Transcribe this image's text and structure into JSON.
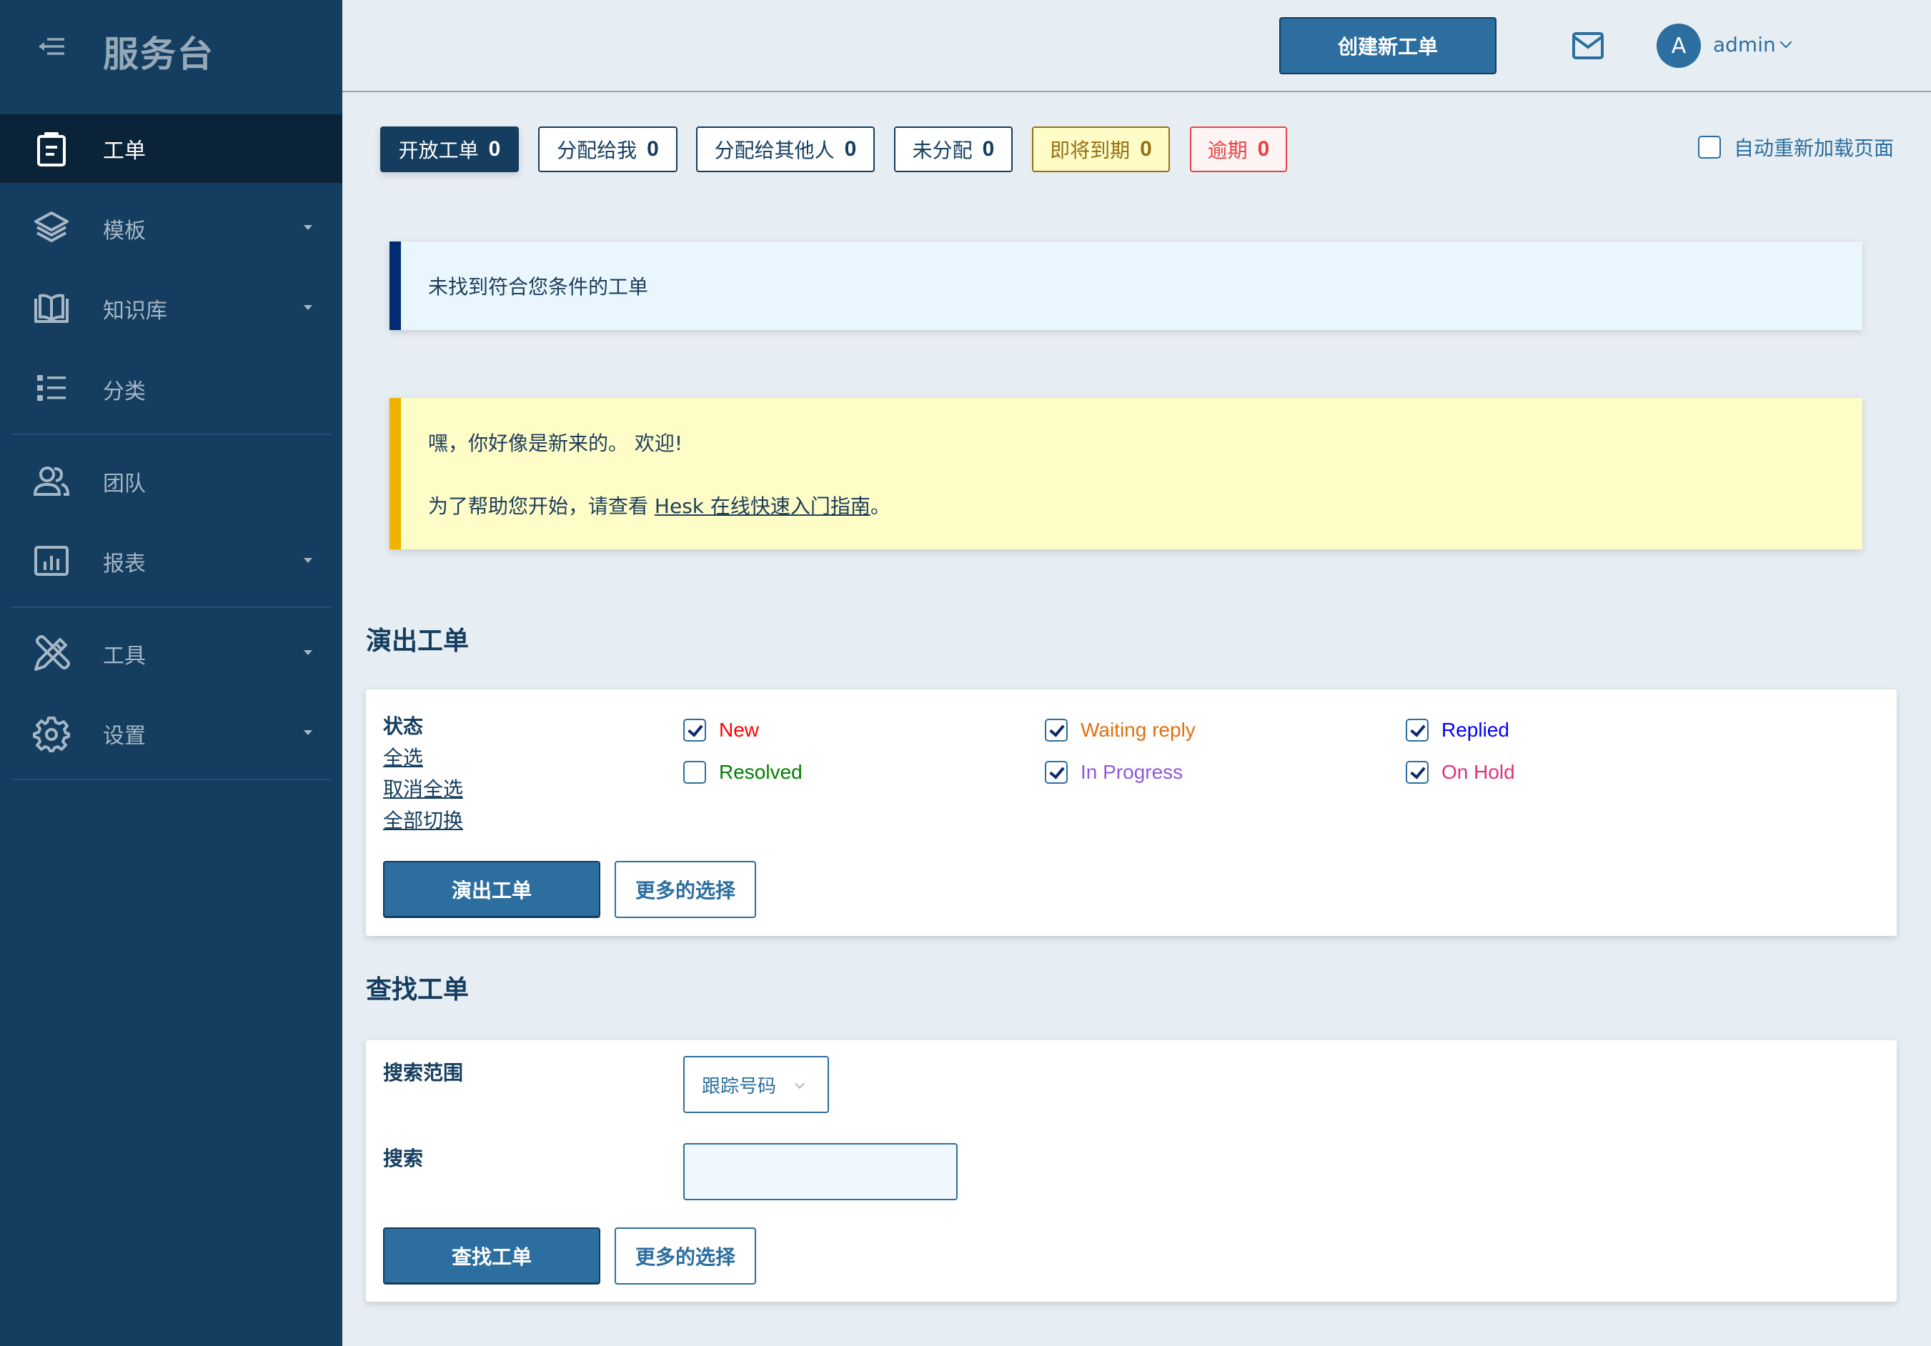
{
  "sidebar": {
    "brand": "服务台",
    "items": [
      {
        "label": "工单",
        "icon": "clipboard-icon",
        "active": true,
        "has_submenu": false
      },
      {
        "label": "模板",
        "icon": "layers-icon",
        "active": false,
        "has_submenu": true
      },
      {
        "label": "知识库",
        "icon": "book-open-icon",
        "active": false,
        "has_submenu": true
      },
      {
        "label": "分类",
        "icon": "list-icon",
        "active": false,
        "has_submenu": false
      },
      {
        "label": "团队",
        "icon": "users-icon",
        "active": false,
        "has_submenu": false
      },
      {
        "label": "报表",
        "icon": "bar-chart-icon",
        "active": false,
        "has_submenu": true
      },
      {
        "label": "工具",
        "icon": "tools-icon",
        "active": false,
        "has_submenu": true
      },
      {
        "label": "设置",
        "icon": "gear-icon",
        "active": false,
        "has_submenu": true
      }
    ]
  },
  "header": {
    "create_ticket_label": "创建新工单",
    "avatar_initial": "A",
    "username": "admin"
  },
  "filters": {
    "tabs": [
      {
        "label": "开放工单",
        "count": "0",
        "style": "active"
      },
      {
        "label": "分配给我",
        "count": "0",
        "style": "default"
      },
      {
        "label": "分配给其他人",
        "count": "0",
        "style": "default"
      },
      {
        "label": "未分配",
        "count": "0",
        "style": "default"
      },
      {
        "label": "即将到期",
        "count": "0",
        "style": "warn"
      },
      {
        "label": "逾期",
        "count": "0",
        "style": "danger"
      }
    ],
    "auto_reload_label": "自动重新加载页面",
    "auto_reload_checked": false
  },
  "notices": {
    "info_text": "未找到符合您条件的工单",
    "welcome_line1": "嘿，你好像是新来的。 欢迎!",
    "welcome_line2_prefix": "为了帮助您开始，请查看 ",
    "welcome_link": "Hesk 在线快速入门指南",
    "welcome_line2_suffix": "。"
  },
  "show_tickets": {
    "heading": "演出工单",
    "status_label": "状态",
    "select_all": "全选",
    "deselect_all": "取消全选",
    "toggle_all": "全部切换",
    "statuses": [
      {
        "label": "New",
        "checked": true,
        "color": "#ff0000"
      },
      {
        "label": "Waiting reply",
        "checked": true,
        "color": "#e0700f"
      },
      {
        "label": "Replied",
        "checked": true,
        "color": "#0000ff"
      },
      {
        "label": "Resolved",
        "checked": false,
        "color": "#008000"
      },
      {
        "label": "In Progress",
        "checked": true,
        "color": "#9159d9"
      },
      {
        "label": "On Hold",
        "checked": true,
        "color": "#e0317f"
      }
    ],
    "submit_label": "演出工单",
    "more_options_label": "更多的选择"
  },
  "find_tickets": {
    "heading": "查找工单",
    "scope_label": "搜索范围",
    "scope_value": "跟踪号码",
    "search_label": "搜索",
    "search_value": "",
    "submit_label": "查找工单",
    "more_options_label": "更多的选择"
  }
}
